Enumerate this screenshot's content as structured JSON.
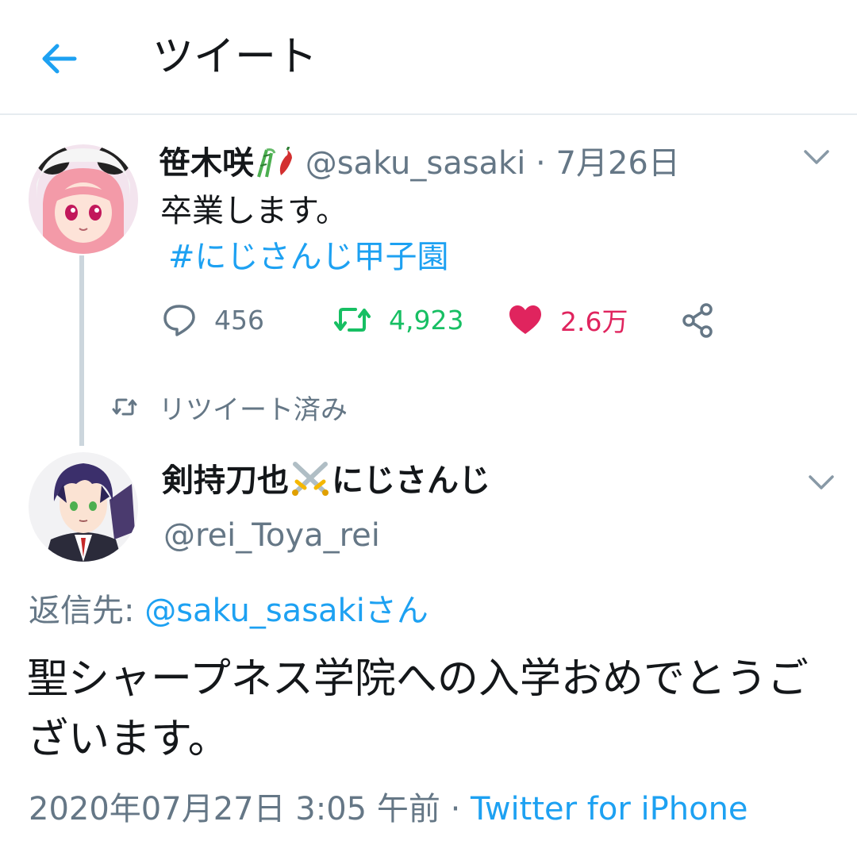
{
  "header": {
    "title": "ツイート",
    "back_icon": "back-arrow-icon"
  },
  "colors": {
    "accent": "#1da1f2",
    "retweet": "#17bf63",
    "like": "#e0245e",
    "muted": "#657786",
    "text": "#14171a"
  },
  "tweet1": {
    "display_name": "笹木咲",
    "name_emoji": [
      "bamboo-icon",
      "chili-pepper-icon"
    ],
    "handle": "@saku_sasaki",
    "separator": " · ",
    "date": "7月26日",
    "text": "卒業します。",
    "hashtag": "#にじさんじ甲子園",
    "actions": {
      "reply_count": "456",
      "retweet_count": "4,923",
      "like_count": "2.6万"
    }
  },
  "retweeted_label": "リツイート済み",
  "tweet2": {
    "display_name": "剣持刀也",
    "name_emoji": "crossed-swords-icon",
    "display_name_suffix": "にじさんじ",
    "handle": "@rei_Toya_rei",
    "reply_prefix": "返信先: ",
    "reply_to": "@saku_sasakiさん",
    "text": "聖シャープネス学院への入学おめでとうございます。",
    "timestamp": "2020年07月27日 3:05 午前",
    "meta_separator": " · ",
    "source": "Twitter for iPhone"
  }
}
